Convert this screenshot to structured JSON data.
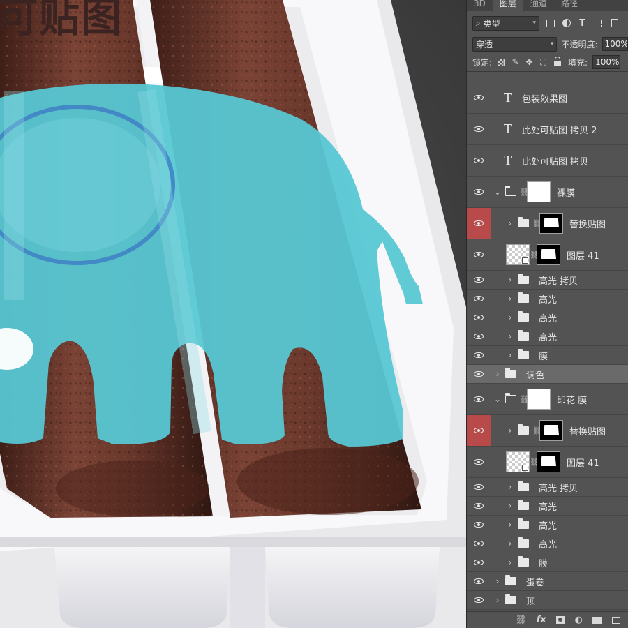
{
  "canvas": {
    "overlay_text": "可贴图",
    "colors": {
      "elephant": "#57c7d3",
      "elephant_ear_ring": "#3e7fc4",
      "cake_roll": "#6e3b2f",
      "tray": "#f4f4f4"
    }
  },
  "panel": {
    "tabs": [
      {
        "label": "3D",
        "active": false
      },
      {
        "label": "图层",
        "active": true
      },
      {
        "label": "通道",
        "active": false
      },
      {
        "label": "路径",
        "active": false
      }
    ],
    "filter": {
      "kind_label": "类型",
      "icons": [
        "image-filter-icon",
        "adjustment-filter-icon",
        "type-filter-icon",
        "shape-filter-icon",
        "smart-object-filter-icon"
      ]
    },
    "blend": {
      "mode": "穿透",
      "opacity_label": "不透明度:",
      "opacity_value": "100%"
    },
    "lock": {
      "label": "锁定:",
      "fill_label": "填充:",
      "fill_value": "100%"
    },
    "layers": [
      {
        "name": "包装效果图",
        "kind": "text",
        "indent": 0
      },
      {
        "name": "此处可贴图 拷贝 2",
        "kind": "text",
        "indent": 0
      },
      {
        "name": "此处可贴图 拷贝",
        "kind": "text",
        "indent": 0
      },
      {
        "name": "裸膜",
        "kind": "group-open",
        "indent": 0
      },
      {
        "name": "替换贴图",
        "kind": "group-mask",
        "indent": 1,
        "hidden": true
      },
      {
        "name": "图层 41",
        "kind": "smart",
        "indent": 1
      },
      {
        "name": "高光 拷贝",
        "kind": "group",
        "indent": 1
      },
      {
        "name": "高光",
        "kind": "group",
        "indent": 1
      },
      {
        "name": "高光",
        "kind": "group",
        "indent": 1
      },
      {
        "name": "高光",
        "kind": "group",
        "indent": 1
      },
      {
        "name": "膜",
        "kind": "group",
        "indent": 1
      },
      {
        "name": "调色",
        "kind": "group",
        "indent": 0,
        "selected": true
      },
      {
        "name": "印花 膜",
        "kind": "group-open",
        "indent": 0
      },
      {
        "name": "替换贴图",
        "kind": "group-mask",
        "indent": 1,
        "hidden": true
      },
      {
        "name": "图层 41",
        "kind": "smart",
        "indent": 1
      },
      {
        "name": "高光 拷贝",
        "kind": "group",
        "indent": 1
      },
      {
        "name": "高光",
        "kind": "group",
        "indent": 1
      },
      {
        "name": "高光",
        "kind": "group",
        "indent": 1
      },
      {
        "name": "高光",
        "kind": "group",
        "indent": 1
      },
      {
        "name": "膜",
        "kind": "group",
        "indent": 1
      },
      {
        "name": "蛋卷",
        "kind": "group",
        "indent": 0
      },
      {
        "name": "顶",
        "kind": "group",
        "indent": 0
      }
    ],
    "bottom_icons": [
      "link-layers-icon",
      "fx-icon",
      "add-mask-icon",
      "adjustment-layer-icon",
      "new-group-icon",
      "new-layer-icon"
    ],
    "fx_label": "fx"
  }
}
